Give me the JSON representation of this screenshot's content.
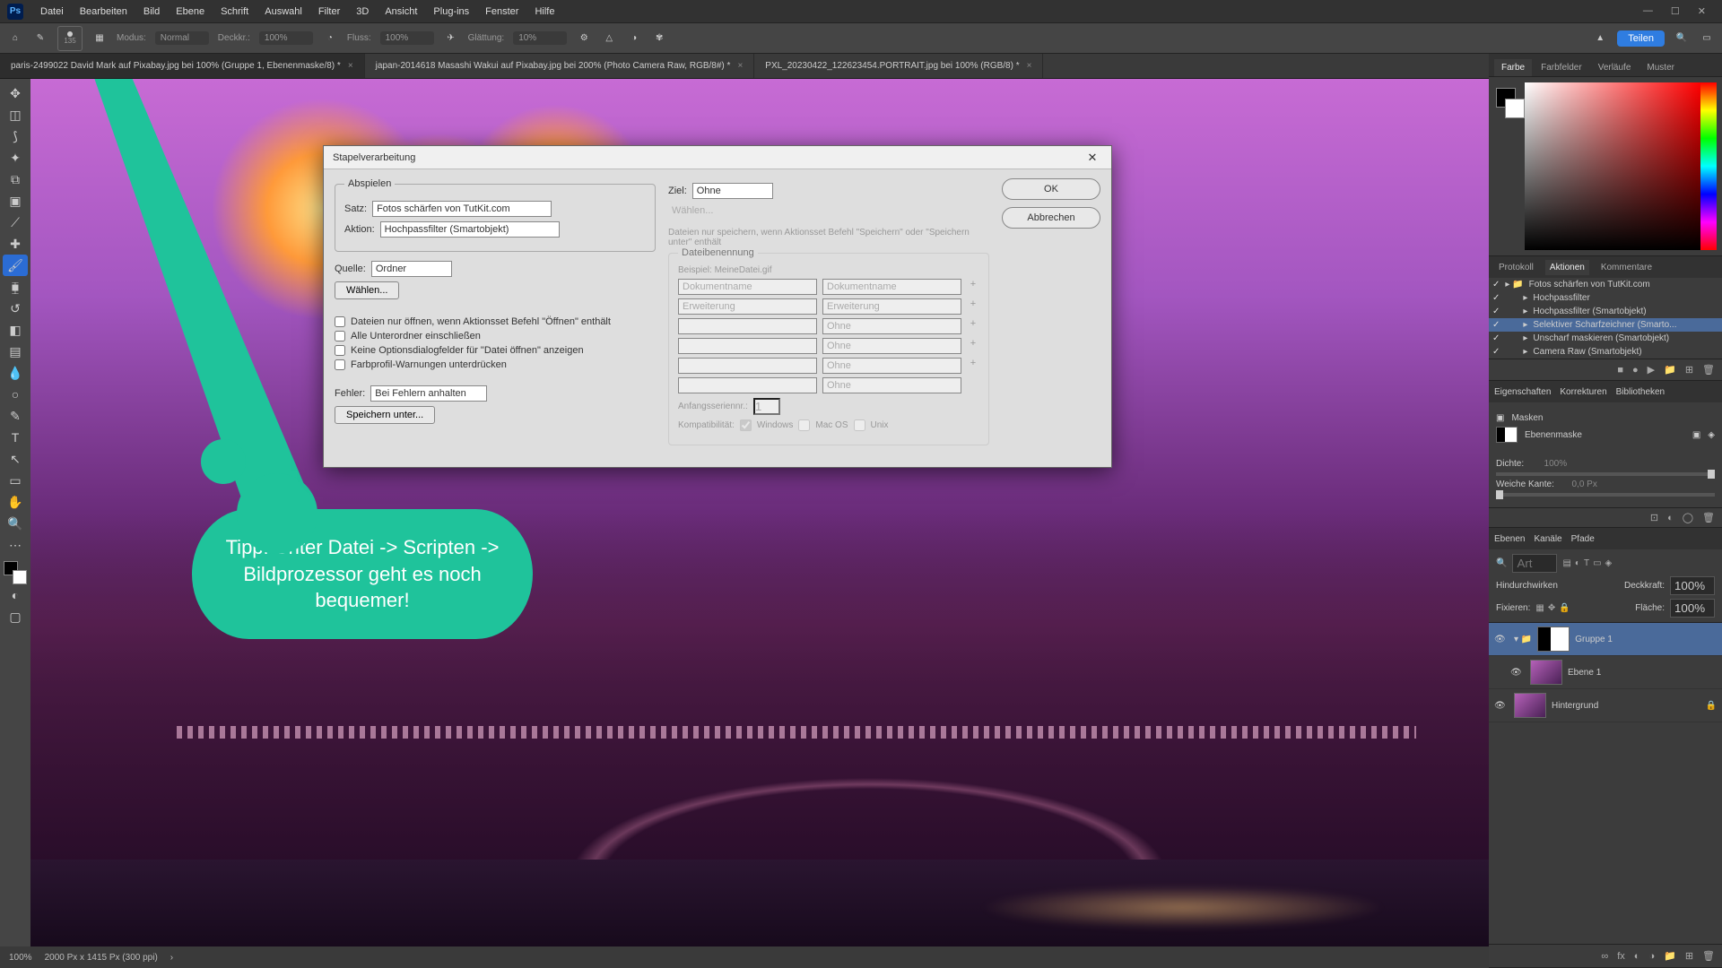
{
  "menu": [
    "Datei",
    "Bearbeiten",
    "Bild",
    "Ebene",
    "Schrift",
    "Auswahl",
    "Filter",
    "3D",
    "Ansicht",
    "Plug-ins",
    "Fenster",
    "Hilfe"
  ],
  "optbar": {
    "brush_size": "135",
    "mode_label": "Modus:",
    "mode_value": "Normal",
    "opacity_label": "Deckkr.:",
    "opacity_value": "100%",
    "flow_label": "Fluss:",
    "flow_value": "100%",
    "smoothing_label": "Glättung:",
    "smoothing_value": "10%",
    "share": "Teilen"
  },
  "tabs": [
    {
      "label": "paris-2499022 David Mark auf Pixabay.jpg bei 100% (Gruppe 1, Ebenenmaske/8) *",
      "active": true
    },
    {
      "label": "japan-2014618 Masashi Wakui auf Pixabay.jpg bei 200% (Photo Camera Raw, RGB/8#) *",
      "active": false
    },
    {
      "label": "PXL_20230422_122623454.PORTRAIT.jpg bei 100% (RGB/8) *",
      "active": false
    }
  ],
  "tip_text": "Tipp: Unter Datei -> Scripten -> Bildprozessor geht es noch bequemer!",
  "dialog": {
    "title": "Stapelverarbeitung",
    "ok": "OK",
    "cancel": "Abbrechen",
    "play_group": "Abspielen",
    "set_label": "Satz:",
    "set_value": "Fotos schärfen von TutKit.com",
    "action_label": "Aktion:",
    "action_value": "Hochpassfilter (Smartobjekt)",
    "source_label": "Quelle:",
    "source_value": "Ordner",
    "choose": "Wählen...",
    "chk_open": "Dateien nur öffnen, wenn Aktionsset Befehl \"Öffnen\" enthält",
    "chk_sub": "Alle Unterordner einschließen",
    "chk_noopt": "Keine Optionsdialogfelder für \"Datei öffnen\" anzeigen",
    "chk_profile": "Farbprofil-Warnungen unterdrücken",
    "errors_label": "Fehler:",
    "errors_value": "Bei Fehlern anhalten",
    "save_as": "Speichern unter...",
    "dest_label": "Ziel:",
    "dest_value": "Ohne",
    "dest_choose": "Wählen...",
    "dest_hint": "Dateien nur speichern, wenn Aktionsset Befehl \"Speichern\" oder \"Speichern unter\" enthält",
    "naming_group": "Dateibenennung",
    "naming_example": "Beispiel: MeineDatei.gif",
    "naming_rows": [
      [
        "Dokumentname",
        "Dokumentname"
      ],
      [
        "Erweiterung",
        "Erweiterung"
      ],
      [
        "",
        "Ohne"
      ],
      [
        "",
        "Ohne"
      ],
      [
        "",
        "Ohne"
      ],
      [
        "",
        "Ohne"
      ]
    ],
    "startnum_label": "Anfangsseriennr.:",
    "startnum_value": "1",
    "compat_label": "Kompatibilität:",
    "compat_win": "Windows",
    "compat_mac": "Mac OS",
    "compat_unix": "Unix"
  },
  "right": {
    "color_tabs": [
      "Farbe",
      "Farbfelder",
      "Verläufe",
      "Muster"
    ],
    "actions_tabs": [
      "Protokoll",
      "Aktionen",
      "Kommentare"
    ],
    "actions_set": "Fotos schärfen von TutKit.com",
    "actions_items": [
      {
        "label": "Hochpassfilter",
        "sel": false
      },
      {
        "label": "Hochpassfilter (Smartobjekt)",
        "sel": false
      },
      {
        "label": "Selektiver Scharfzeichner (Smarto...",
        "sel": true
      },
      {
        "label": "Unscharf maskieren (Smartobjekt)",
        "sel": false
      },
      {
        "label": "Camera Raw (Smartobjekt)",
        "sel": false
      }
    ],
    "props_tabs": [
      "Eigenschaften",
      "Korrekturen",
      "Bibliotheken"
    ],
    "props_masks": "Masken",
    "props_mask_label": "Ebenenmaske",
    "props_density_label": "Dichte:",
    "props_density_value": "100%",
    "props_feather_label": "Weiche Kante:",
    "props_feather_value": "0,0 Px",
    "layers_tabs": [
      "Ebenen",
      "Kanäle",
      "Pfade"
    ],
    "layers_search_ph": "Art",
    "layers_blend_label": "Hindurchwirken",
    "layers_opacity_label": "Deckkraft:",
    "layers_opacity_value": "100%",
    "layers_lock_label": "Fixieren:",
    "layers_fill_label": "Fläche:",
    "layers_fill_value": "100%",
    "layers": [
      {
        "name": "Gruppe 1",
        "sel": true,
        "group": true
      },
      {
        "name": "Ebene 1",
        "sel": false
      },
      {
        "name": "Hintergrund",
        "sel": false,
        "locked": true
      }
    ]
  },
  "status": {
    "zoom": "100%",
    "info": "2000 Px x 1415 Px (300 ppi)"
  }
}
